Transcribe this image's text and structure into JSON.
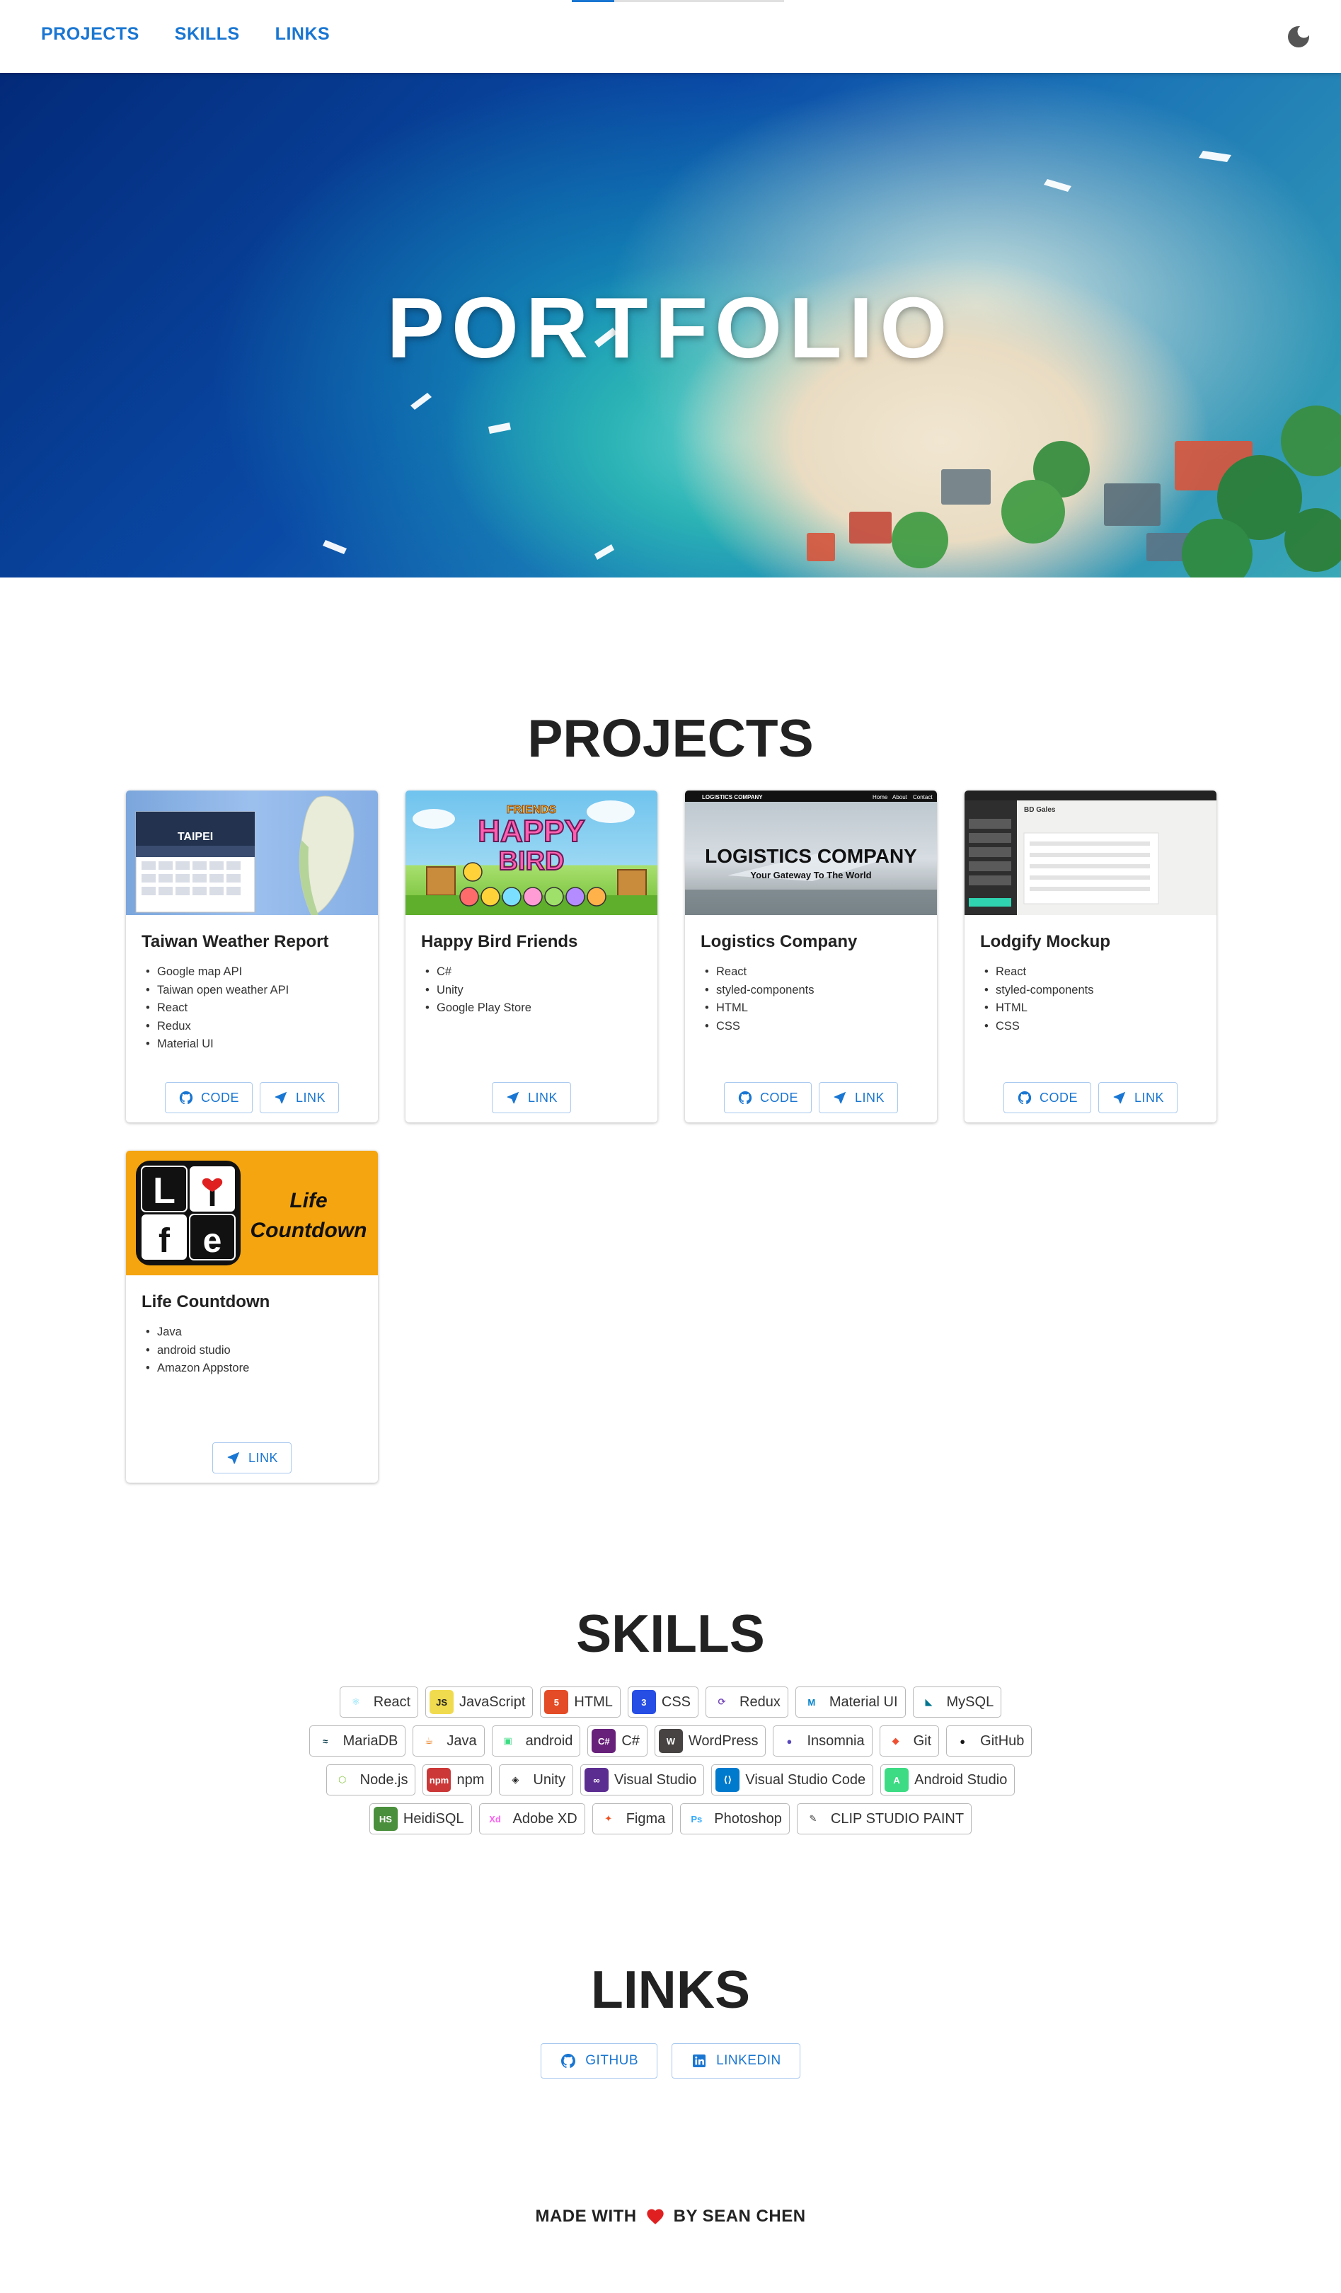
{
  "nav": {
    "links": [
      "PROJECTS",
      "SKILLS",
      "LINKS"
    ],
    "scroll_progress": 0.2,
    "theme_icon": "moon-icon"
  },
  "hero": {
    "title": "PORTFOLIO"
  },
  "projects": {
    "title": "PROJECTS",
    "items": [
      {
        "title": "Taiwan Weather Report",
        "tags": [
          "Google map API",
          "Taiwan open weather API",
          "React",
          "Redux",
          "Material UI"
        ],
        "image_text": "TAIPEI",
        "actions": [
          "CODE",
          "LINK"
        ]
      },
      {
        "title": "Happy Bird Friends",
        "tags": [
          "C#",
          "Unity",
          "Google Play Store"
        ],
        "image_text": [
          "FRIENDS",
          "HAPPY",
          "BIRD"
        ],
        "actions": [
          "LINK"
        ]
      },
      {
        "title": "Logistics Company",
        "tags": [
          "React",
          "styled-components",
          "HTML",
          "CSS"
        ],
        "image_text": [
          "LOGISTICS COMPANY",
          "Your Gateway To The World",
          "LOGISTICS COMPANY",
          "Home",
          "About",
          "Contact"
        ],
        "actions": [
          "CODE",
          "LINK"
        ]
      },
      {
        "title": "Lodgify Mockup",
        "tags": [
          "React",
          "styled-components",
          "HTML",
          "CSS"
        ],
        "image_text": [
          "BD Gales"
        ],
        "actions": [
          "CODE",
          "LINK"
        ]
      },
      {
        "title": "Life Countdown",
        "tags": [
          "Java",
          "android studio",
          "Amazon Appstore"
        ],
        "image_text": [
          "L",
          "i",
          "f",
          "e",
          "Life",
          "Countdown"
        ],
        "actions": [
          "LINK"
        ]
      }
    ]
  },
  "skills": {
    "title": "SKILLS",
    "rows": [
      [
        {
          "label": "React",
          "icon": "react-icon",
          "glyph": "⚛",
          "color": "#61dafb",
          "bg": "#ffffff"
        },
        {
          "label": "JavaScript",
          "icon": "javascript-icon",
          "glyph": "JS",
          "color": "#222222",
          "bg": "#f0db4f"
        },
        {
          "label": "HTML",
          "icon": "html-icon",
          "glyph": "5",
          "color": "#ffffff",
          "bg": "#e34c26"
        },
        {
          "label": "CSS",
          "icon": "css-icon",
          "glyph": "3",
          "color": "#ffffff",
          "bg": "#264de4"
        },
        {
          "label": "Redux",
          "icon": "redux-icon",
          "glyph": "⟳",
          "color": "#764abc",
          "bg": "#ffffff"
        },
        {
          "label": "Material UI",
          "icon": "material-ui-icon",
          "glyph": "M",
          "color": "#0081cb",
          "bg": "#ffffff"
        },
        {
          "label": "MySQL",
          "icon": "mysql-icon",
          "glyph": "◣",
          "color": "#00758f",
          "bg": "#ffffff"
        }
      ],
      [
        {
          "label": "MariaDB",
          "icon": "mariadb-icon",
          "glyph": "≈",
          "color": "#003545",
          "bg": "#ffffff"
        },
        {
          "label": "Java",
          "icon": "java-icon",
          "glyph": "☕",
          "color": "#e76f00",
          "bg": "#ffffff"
        },
        {
          "label": "android",
          "icon": "android-icon",
          "glyph": "▣",
          "color": "#3ddc84",
          "bg": "#ffffff"
        },
        {
          "label": "C#",
          "icon": "csharp-icon",
          "glyph": "C#",
          "color": "#ffffff",
          "bg": "#68217a"
        },
        {
          "label": "WordPress",
          "icon": "wordpress-icon",
          "glyph": "W",
          "color": "#ffffff",
          "bg": "#464342"
        },
        {
          "label": "Insomnia",
          "icon": "insomnia-icon",
          "glyph": "●",
          "color": "#5849be",
          "bg": "#ffffff"
        },
        {
          "label": "Git",
          "icon": "git-icon",
          "glyph": "◆",
          "color": "#f05032",
          "bg": "#ffffff"
        },
        {
          "label": "GitHub",
          "icon": "github-icon",
          "glyph": "●",
          "color": "#181717",
          "bg": "#ffffff"
        }
      ],
      [
        {
          "label": "Node.js",
          "icon": "nodejs-icon",
          "glyph": "⬡",
          "color": "#8cc84b",
          "bg": "#ffffff"
        },
        {
          "label": "npm",
          "icon": "npm-icon",
          "glyph": "npm",
          "color": "#ffffff",
          "bg": "#cb3837"
        },
        {
          "label": "Unity",
          "icon": "unity-icon",
          "glyph": "◈",
          "color": "#222222",
          "bg": "#ffffff"
        },
        {
          "label": "Visual Studio",
          "icon": "visual-studio-icon",
          "glyph": "∞",
          "color": "#ffffff",
          "bg": "#5c2d91"
        },
        {
          "label": "Visual Studio Code",
          "icon": "vscode-icon",
          "glyph": "⟨⟩",
          "color": "#ffffff",
          "bg": "#007acc"
        },
        {
          "label": "Android Studio",
          "icon": "android-studio-icon",
          "glyph": "A",
          "color": "#ffffff",
          "bg": "#3ddc84"
        }
      ],
      [
        {
          "label": "HeidiSQL",
          "icon": "heidisql-icon",
          "glyph": "HS",
          "color": "#ffffff",
          "bg": "#4a8f3c"
        },
        {
          "label": "Adobe XD",
          "icon": "adobe-xd-icon",
          "glyph": "Xd",
          "color": "#ff61f6",
          "bg": "#ffffff"
        },
        {
          "label": "Figma",
          "icon": "figma-icon",
          "glyph": "✦",
          "color": "#f24e1e",
          "bg": "#ffffff"
        },
        {
          "label": "Photoshop",
          "icon": "photoshop-icon",
          "glyph": "Ps",
          "color": "#31a8ff",
          "bg": "#ffffff"
        },
        {
          "label": "CLIP STUDIO PAINT",
          "icon": "clip-studio-paint-icon",
          "glyph": "✎",
          "color": "#333333",
          "bg": "#ffffff"
        }
      ]
    ]
  },
  "links": {
    "title": "LINKS",
    "items": [
      {
        "label": "GITHUB",
        "icon": "github-icon"
      },
      {
        "label": "LINKEDIN",
        "icon": "linkedin-icon"
      }
    ]
  },
  "footer": {
    "left": "MADE WITH",
    "right": "BY SEAN CHEN",
    "icon": "heart-icon",
    "heart_color": "#e02020"
  },
  "colors": {
    "accent": "#1976d2",
    "text": "#222222"
  }
}
